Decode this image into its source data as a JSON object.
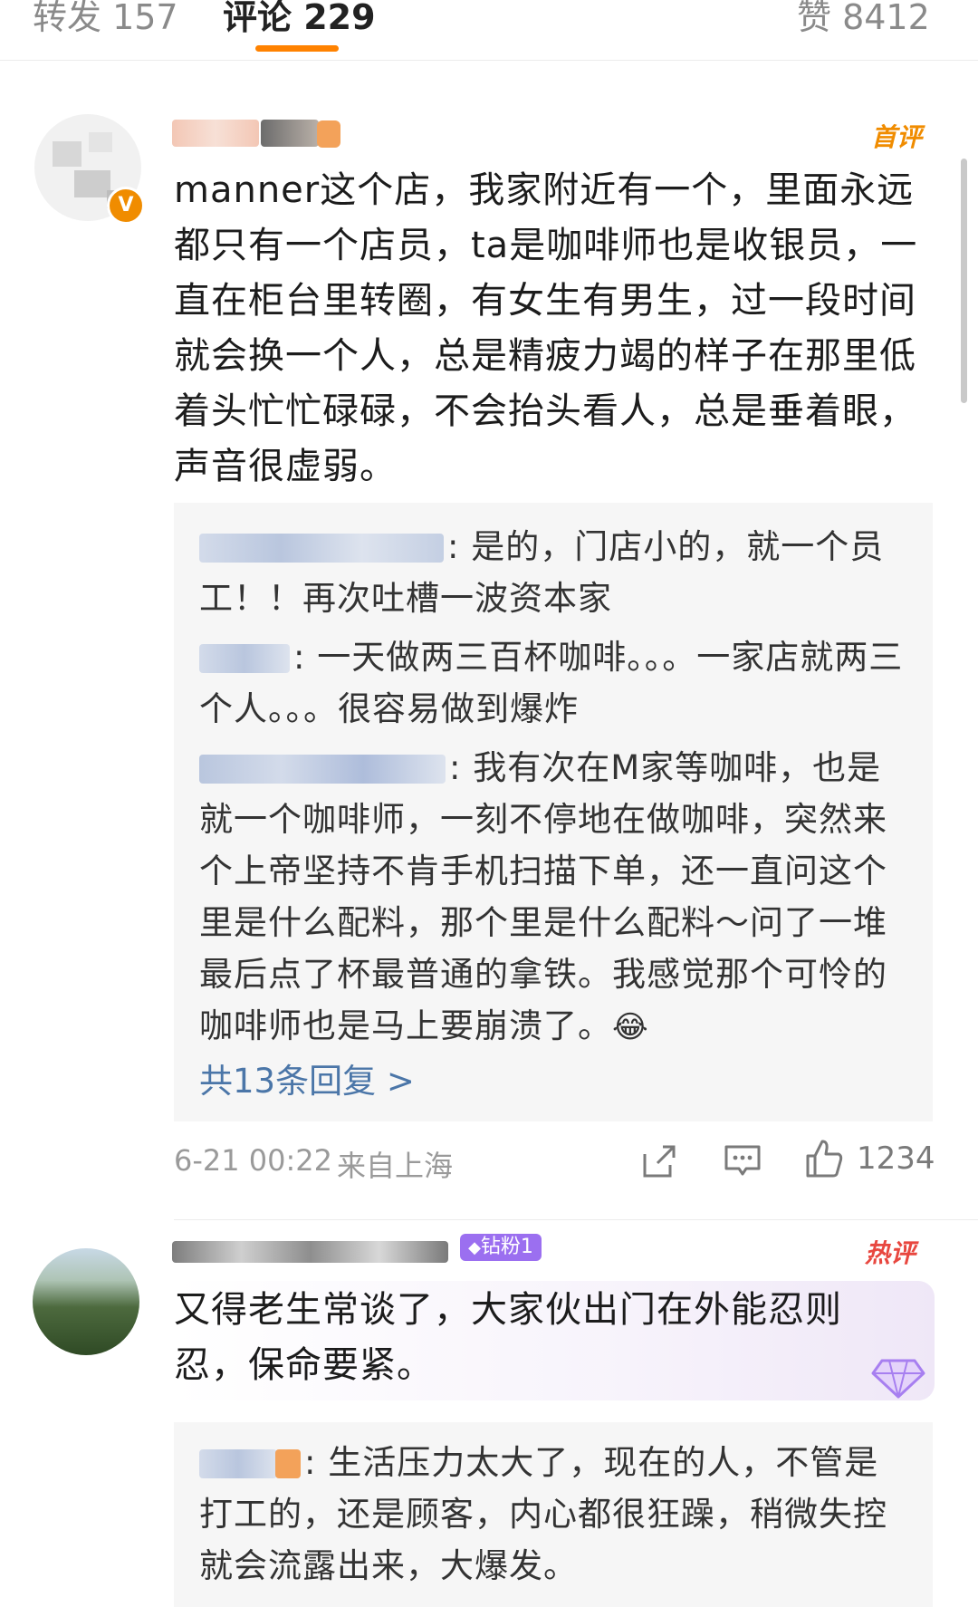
{
  "tabs": {
    "repost": "转发 157",
    "comments": "评论 229",
    "likes": "赞 8412"
  },
  "comment1": {
    "tag": "首评",
    "text": "manner这个店，我家附近有一个，里面永远都只有一个店员，ta是咖啡师也是收银员，一直在柜台里转圈，有女生有男生，过一段时间就会换一个人，总是精疲力竭的样子在那里低着头忙忙碌碌，不会抬头看人，总是垂着眼，声音很虚弱。",
    "replies": [
      ": 是的，门店小的，就一个员工！！再次吐槽一波资本家",
      ": 一天做两三百杯咖啡。。。一家店就两三个人。。。很容易做到爆炸",
      ": 我有次在M家等咖啡，也是就一个咖啡师，一刻不停地在做咖啡，突然来个上帝坚持不肯手机扫描下单，还一直问这个里是什么配料，那个里是什么配料～问了一堆最后点了杯最普通的拿铁。我感觉那个可怜的咖啡师也是马上要崩溃了。"
    ],
    "more_replies": "共13条回复 >",
    "time": "6-21 00:22",
    "location": "来自上海",
    "like_count": "1234"
  },
  "comment2": {
    "badge": "钻粉1",
    "tag": "热评",
    "text": "又得老生常谈了，大家伙出门在外能忍则忍，保命要紧。",
    "replies": [
      ": 生活压力太大了，现在的人，不管是打工的，还是顾客，内心都很狂躁，稍微失控就会流露出来，大爆发。"
    ]
  },
  "colors": {
    "accent": "#ff8200",
    "link": "#4b76a8",
    "hot_tag": "#e8473f",
    "fan_badge": "#9b6ff0"
  },
  "icons": [
    "share-icon",
    "comment-icon",
    "like-icon",
    "verified-icon",
    "diamond-icon",
    "laugh-cry-emoji"
  ]
}
